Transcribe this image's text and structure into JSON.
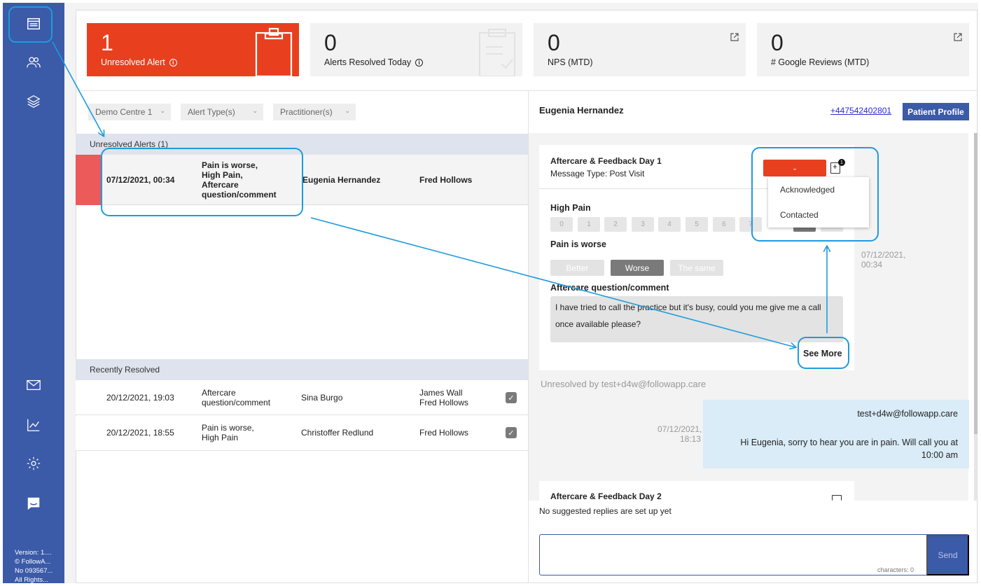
{
  "sidebar": {
    "items": [
      {
        "name": "alerts-nav",
        "icon": "inbox-icon"
      },
      {
        "name": "patients-nav",
        "icon": "users-icon"
      },
      {
        "name": "layers-nav",
        "icon": "layers-icon"
      },
      {
        "name": "messages-nav",
        "icon": "mail-icon"
      },
      {
        "name": "analytics-nav",
        "icon": "chart-line-icon"
      },
      {
        "name": "settings-nav",
        "icon": "gear-icon"
      },
      {
        "name": "chat-nav",
        "icon": "chat-icon"
      }
    ],
    "version_lines": [
      "Version: 1....",
      "© FollowA...",
      "No 093567...",
      "All Rights..."
    ]
  },
  "stats": {
    "unresolved": {
      "value": "1",
      "label": "Unresolved Alert"
    },
    "resolved_today": {
      "value": "0",
      "label": "Alerts Resolved Today"
    },
    "nps": {
      "value": "0",
      "label": "NPS (MTD)"
    },
    "google": {
      "value": "0",
      "label": "# Google Reviews (MTD)"
    }
  },
  "filters": {
    "centre": "Demo Centre 1",
    "alert_type": "Alert Type(s)",
    "practitioner": "Practitioner(s)"
  },
  "unresolved": {
    "heading": "Unresolved Alerts (1)",
    "rows": [
      {
        "datetime": "07/12/2021, 00:34",
        "reason": [
          "Pain is worse,",
          "High Pain,",
          "Aftercare",
          "question/comment"
        ],
        "patient": "Eugenia Hernandez",
        "practitioner": "Fred Hollows"
      }
    ]
  },
  "resolved": {
    "heading": "Recently Resolved",
    "rows": [
      {
        "datetime": "20/12/2021, 19:03",
        "reason": [
          "Aftercare",
          "question/comment"
        ],
        "patient": "Sina Burgo",
        "practitioner": [
          "James Wall",
          "Fred Hollows"
        ]
      },
      {
        "datetime": "20/12/2021, 18:55",
        "reason": [
          "Pain is worse,",
          "High Pain"
        ],
        "patient": "Christoffer Redlund",
        "practitioner": [
          "Fred Hollows"
        ]
      }
    ]
  },
  "patient": {
    "name": "Eugenia Hernandez",
    "phone": "+447542402801",
    "profile_button": "Patient Profile"
  },
  "message": {
    "title": "Aftercare & Feedback Day 1",
    "type": "Message Type: Post Visit",
    "timestamp": [
      "07/12/2021,",
      "00:34"
    ],
    "high_pain_label": "High Pain",
    "scale": [
      "0",
      "1",
      "2",
      "3",
      "4",
      "5",
      "6",
      "7",
      "8",
      "9"
    ],
    "pain_label": "Pain is worse",
    "choices": [
      "Better",
      "Worse",
      "The same"
    ],
    "comment_label": "Aftercare question/comment",
    "comment": [
      "I have tried to call the practice but it's busy, could you me give me a call",
      "once available please?"
    ],
    "see_more": "See More",
    "status_options": [
      "Acknowledged",
      "Contacted"
    ],
    "note_badge": "1"
  },
  "resolved_by": "Unresolved by test+d4w@followapp.care",
  "reply": {
    "author": "test+d4w@followapp.care",
    "timestamp": [
      "07/12/2021,",
      "18:13"
    ],
    "text": [
      "Hi Eugenia, sorry to hear you are in pain. Will call you at",
      "10:00 am"
    ]
  },
  "message2": {
    "title": "Aftercare & Feedback Day 2"
  },
  "composer": {
    "suggested": "No suggested replies are set up yet",
    "char_count": "characters: 0",
    "send": "Send"
  },
  "colors": {
    "brand": "#3b5aa8",
    "alert": "#e8401f",
    "annotation": "#1e9bdc"
  }
}
